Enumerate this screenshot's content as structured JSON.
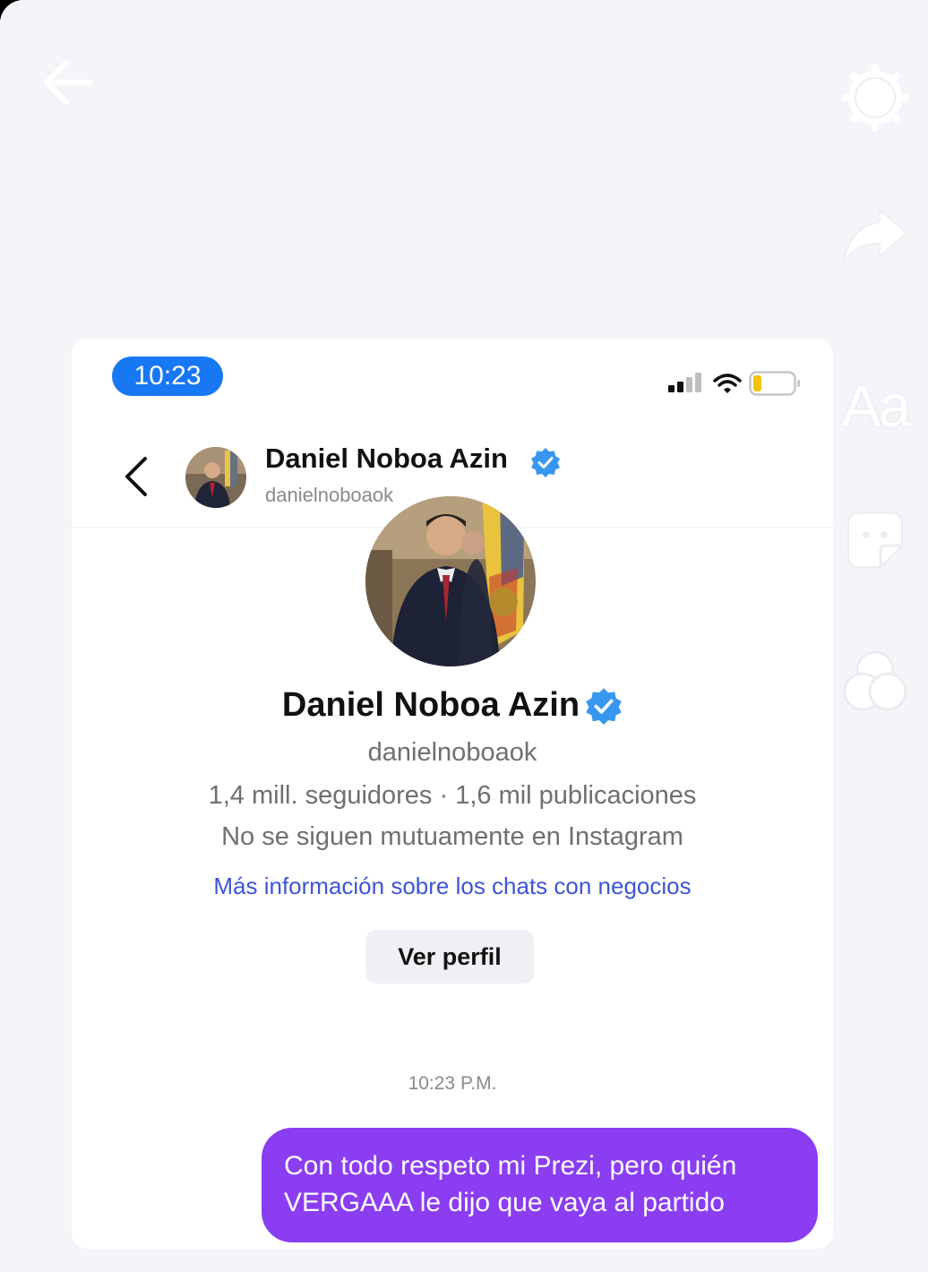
{
  "status_bar": {
    "time": "10:23"
  },
  "chat_header": {
    "name": "Daniel Noboa Azin",
    "handle": "danielnoboaok"
  },
  "profile": {
    "name": "Daniel Noboa Azin",
    "handle": "danielnoboaok",
    "stats": "1,4 mill. seguidores · 1,6 mil publicaciones",
    "mutual": "No se siguen mutuamente en Instagram",
    "business_link": "Más información sobre los chats con negocios",
    "view_profile_label": "Ver perfil"
  },
  "conversation": {
    "timestamp": "10:23 P.M.",
    "messages": [
      {
        "text": "Con todo respeto mi Prezi, pero quién VERGAAA le dijo que vaya al partido",
        "from": "me"
      }
    ]
  },
  "story_tools": {
    "text_tool_label": "Aa"
  },
  "icons": {
    "story_back": "arrow-left-icon",
    "settings": "gear-icon",
    "share": "share-arrow-icon",
    "sticker": "sticker-icon",
    "effects": "effects-circles-icon",
    "verified": "verified-badge-icon",
    "chat_back": "chevron-left-icon"
  },
  "colors": {
    "accent_blue": "#1877f2",
    "verified_blue": "#3797f0",
    "link_blue": "#3d55d6",
    "bubble_purple": "#8b3df2",
    "battery_yellow": "#f4c20d"
  }
}
